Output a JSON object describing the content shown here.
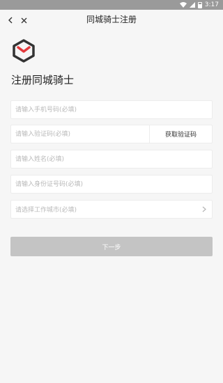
{
  "status_bar": {
    "time": "3:17",
    "icons": [
      "wifi-icon",
      "signal-icon",
      "battery-icon"
    ]
  },
  "header": {
    "title": "同城骑士注册",
    "back_icon": "chevron-left-icon",
    "close_icon": "close-icon"
  },
  "logo": {
    "accent": "#e4393c",
    "dark": "#333333"
  },
  "page_heading": "注册同城骑士",
  "form": {
    "phone_placeholder": "请输入手机号码(必填)",
    "code_placeholder": "请输入验证码(必填)",
    "get_code_label": "获取验证码",
    "name_placeholder": "请输入姓名(必填)",
    "idcard_placeholder": "请输入身份证号码(必填)",
    "city_placeholder": "请选择工作城市(必填)",
    "city_icon": "chevron-right-icon"
  },
  "next_button": "下一步",
  "colors": {
    "background": "#f6f6f6",
    "status_bar": "#9a9a9a",
    "button_disabled": "#c4c4c4"
  }
}
